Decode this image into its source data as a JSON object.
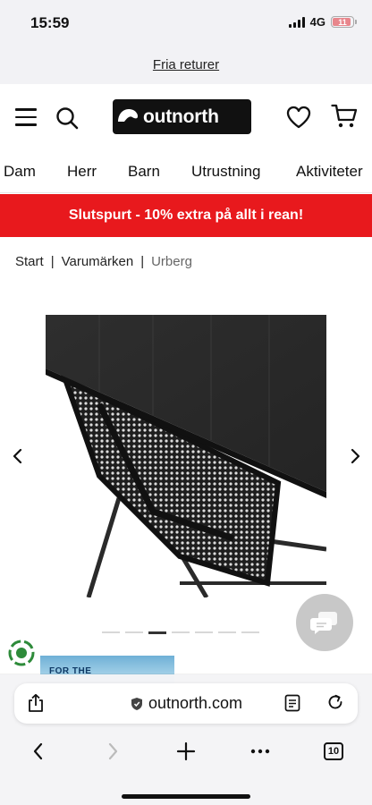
{
  "status_bar": {
    "time": "15:59",
    "network": "4G",
    "battery_level": "11"
  },
  "promo_top": {
    "link_text": "Fria returer"
  },
  "header": {
    "logo_text": "outnorth",
    "icons": [
      "menu-icon",
      "search-icon",
      "heart-icon",
      "cart-icon"
    ]
  },
  "nav": {
    "items": [
      "Dam",
      "Herr",
      "Barn",
      "Utrustning",
      "Aktiviteter"
    ]
  },
  "sale_banner": {
    "text": "Slutspurt - 10% extra på allt i rean!",
    "color": "#e8191d"
  },
  "breadcrumb": {
    "items": [
      "Start",
      "Varumärken",
      "Urberg"
    ],
    "separator": "|"
  },
  "gallery": {
    "slide_count": 7,
    "active_slide": 3
  },
  "browser": {
    "url": "outnorth.com",
    "tab_count": "10"
  },
  "teaser": {
    "banner_text": "FOR THE"
  }
}
